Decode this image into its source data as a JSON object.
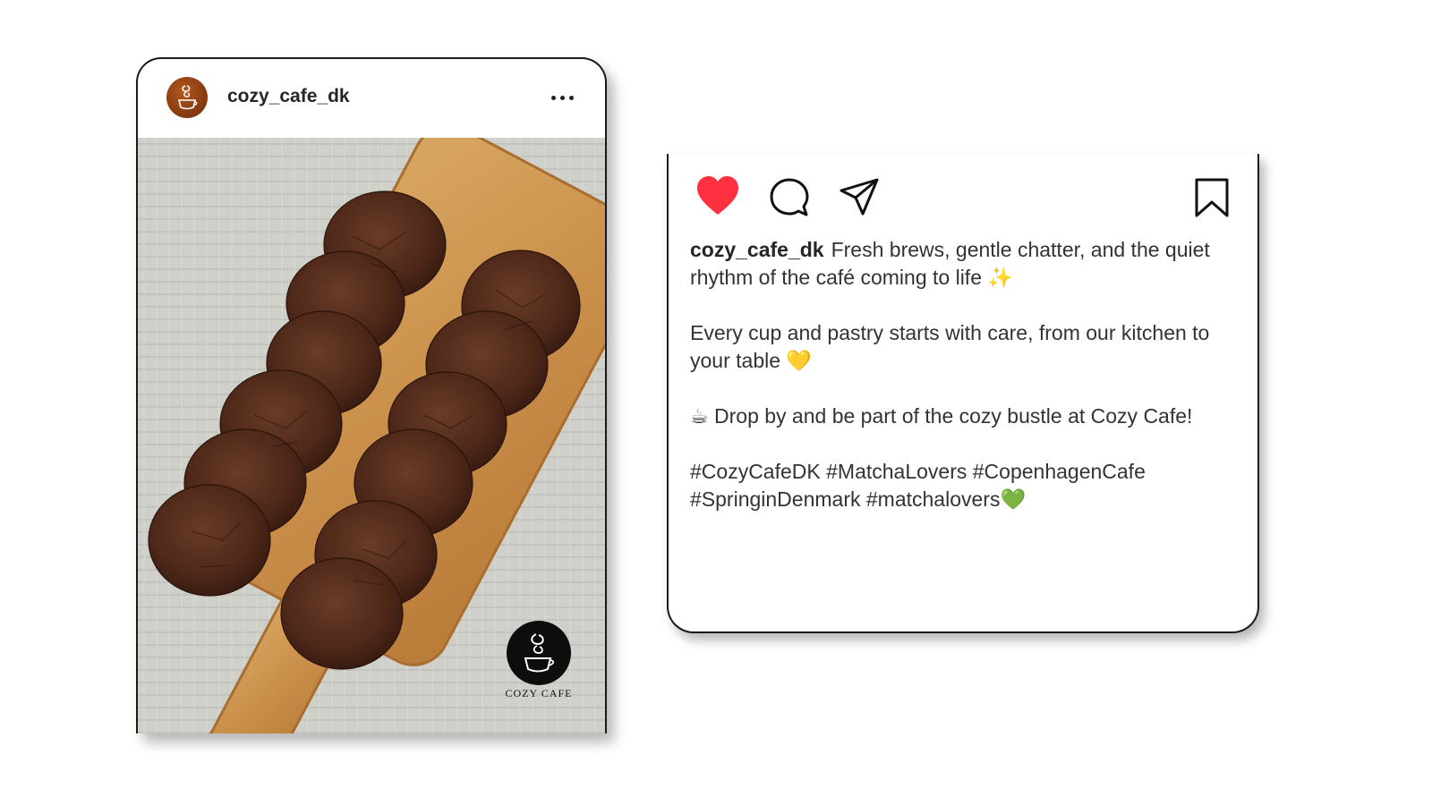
{
  "post": {
    "username": "cozy_cafe_dk",
    "more_label": "•••",
    "watermark_text": "COZY CAFE"
  },
  "caption_card": {
    "actions": {
      "like_icon": "heart-filled-icon",
      "comment_icon": "comment-bubble-icon",
      "share_icon": "paper-plane-icon",
      "save_icon": "bookmark-icon",
      "like_color": "#ff3040"
    },
    "username": "cozy_cafe_dk",
    "line1": "Fresh brews, gentle chatter, and the quiet rhythm of the café coming to life ✨",
    "line2": "Every cup and pastry starts with care, from our kitchen to your table 💛",
    "line3": "☕ Drop by and be part of the cozy bustle at Cozy Cafe!",
    "hashtags": "#CozyCafeDK #MatchaLovers #CopenhagenCafe #SpringinDenmark #matchalovers💚"
  }
}
